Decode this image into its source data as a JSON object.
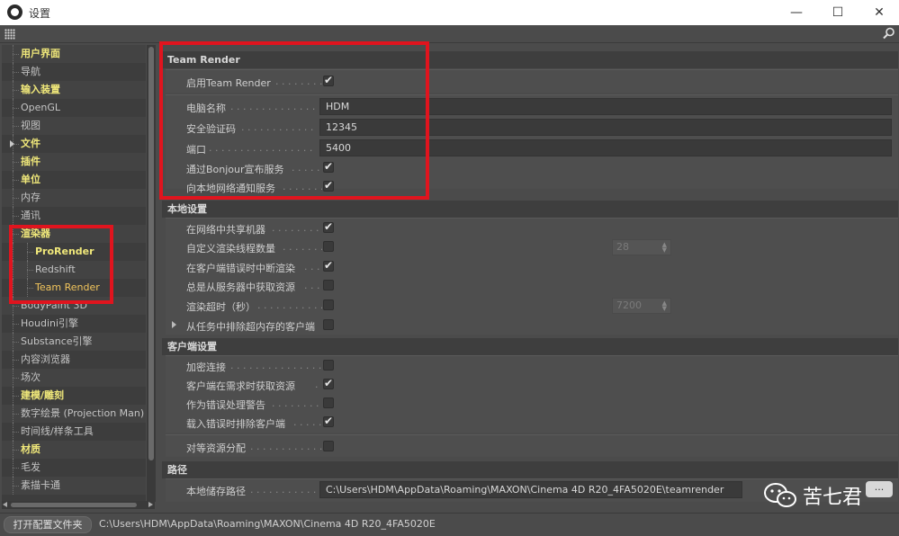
{
  "window": {
    "title": "设置",
    "min": "—",
    "max": "☐",
    "close": "✕"
  },
  "sidebar": {
    "items": [
      {
        "label": "用户界面",
        "bold": true,
        "alt": true
      },
      {
        "label": "导航"
      },
      {
        "label": "输入装置",
        "bold": true,
        "alt": true
      },
      {
        "label": "OpenGL"
      },
      {
        "label": "视图",
        "alt": true
      },
      {
        "label": "文件",
        "bold": true,
        "arrow": true
      },
      {
        "label": "插件",
        "bold": true,
        "alt": true
      },
      {
        "label": "单位",
        "bold": true
      },
      {
        "label": "内存",
        "alt": true
      },
      {
        "label": "通讯"
      },
      {
        "label": "渲染器",
        "bold": true,
        "alt": true
      },
      {
        "label": "ProRender",
        "sub": true,
        "bold2": true
      },
      {
        "label": "Redshift",
        "sub": true,
        "alt": true
      },
      {
        "label": "Team Render",
        "sub": true,
        "selected": true
      },
      {
        "label": "BodyPaint 3D",
        "alt": true
      },
      {
        "label": "Houdini引擎"
      },
      {
        "label": "Substance引擎",
        "alt": true
      },
      {
        "label": "内容浏览器"
      },
      {
        "label": "场次",
        "alt": true
      },
      {
        "label": "建模/雕刻",
        "bold": true
      },
      {
        "label": "数字绘景 (Projection Man)",
        "alt": true
      },
      {
        "label": "时间线/样条工具"
      },
      {
        "label": "材质",
        "bold": true,
        "alt": true
      },
      {
        "label": "毛发"
      },
      {
        "label": "素描卡通",
        "alt": true
      }
    ]
  },
  "main": {
    "team_render": {
      "header": "Team Render",
      "enable_label": "启用Team Render",
      "enable_checked": true,
      "computer_name_label": "电脑名称",
      "computer_name_value": "HDM",
      "security_token_label": "安全验证码",
      "security_token_value": "12345",
      "port_label": "端口",
      "port_value": "5400",
      "bonjour_label": "通过Bonjour宣布服务",
      "bonjour_checked": true,
      "local_notify_label": "向本地网络通知服务",
      "local_notify_checked": true
    },
    "local": {
      "header": "本地设置",
      "share_label": "在网络中共享机器",
      "share_checked": true,
      "custom_threads_label": "自定义渲染线程数量",
      "custom_threads_checked": false,
      "threads_value": "28",
      "abort_label": "在客户端错误时中断渲染",
      "abort_checked": true,
      "always_fetch_label": "总是从服务器中获取资源",
      "always_fetch_checked": false,
      "timeout_label": "渲染超时（秒）",
      "timeout_checked": false,
      "timeout_value": "7200",
      "exclude_label": "从任务中排除超内存的客户端",
      "exclude_checked": false
    },
    "client": {
      "header": "客户端设置",
      "encrypt_label": "加密连接",
      "encrypt_checked": false,
      "fetch_on_demand_label": "客户端在需求时获取资源",
      "fetch_on_demand_checked": true,
      "treat_errors_label": "作为错误处理警告",
      "treat_errors_checked": false,
      "exclude_on_error_label": "载入错误时排除客户端",
      "exclude_on_error_checked": true,
      "p2p_label": "对等资源分配",
      "p2p_checked": false
    },
    "paths": {
      "header": "路径",
      "cache_label": "本地储存路径",
      "cache_value": "C:\\Users\\HDM\\AppData\\Roaming\\MAXON\\Cinema 4D R20_4FA5020E\\teamrender",
      "browse_label": "..."
    }
  },
  "bottom": {
    "open_button": "打开配置文件夹",
    "path": "C:\\Users\\HDM\\AppData\\Roaming\\MAXON\\Cinema 4D R20_4FA5020E"
  },
  "watermark": {
    "text": "苦七君"
  },
  "colors": {
    "annotation": "#e0141e",
    "highlight_text": "#f0e87a",
    "selected_text": "#f2c55c"
  },
  "icons": {
    "app": "cinema4d-icon",
    "grip": "grip-icon",
    "search": "search-icon",
    "wechat": "wechat-icon"
  }
}
